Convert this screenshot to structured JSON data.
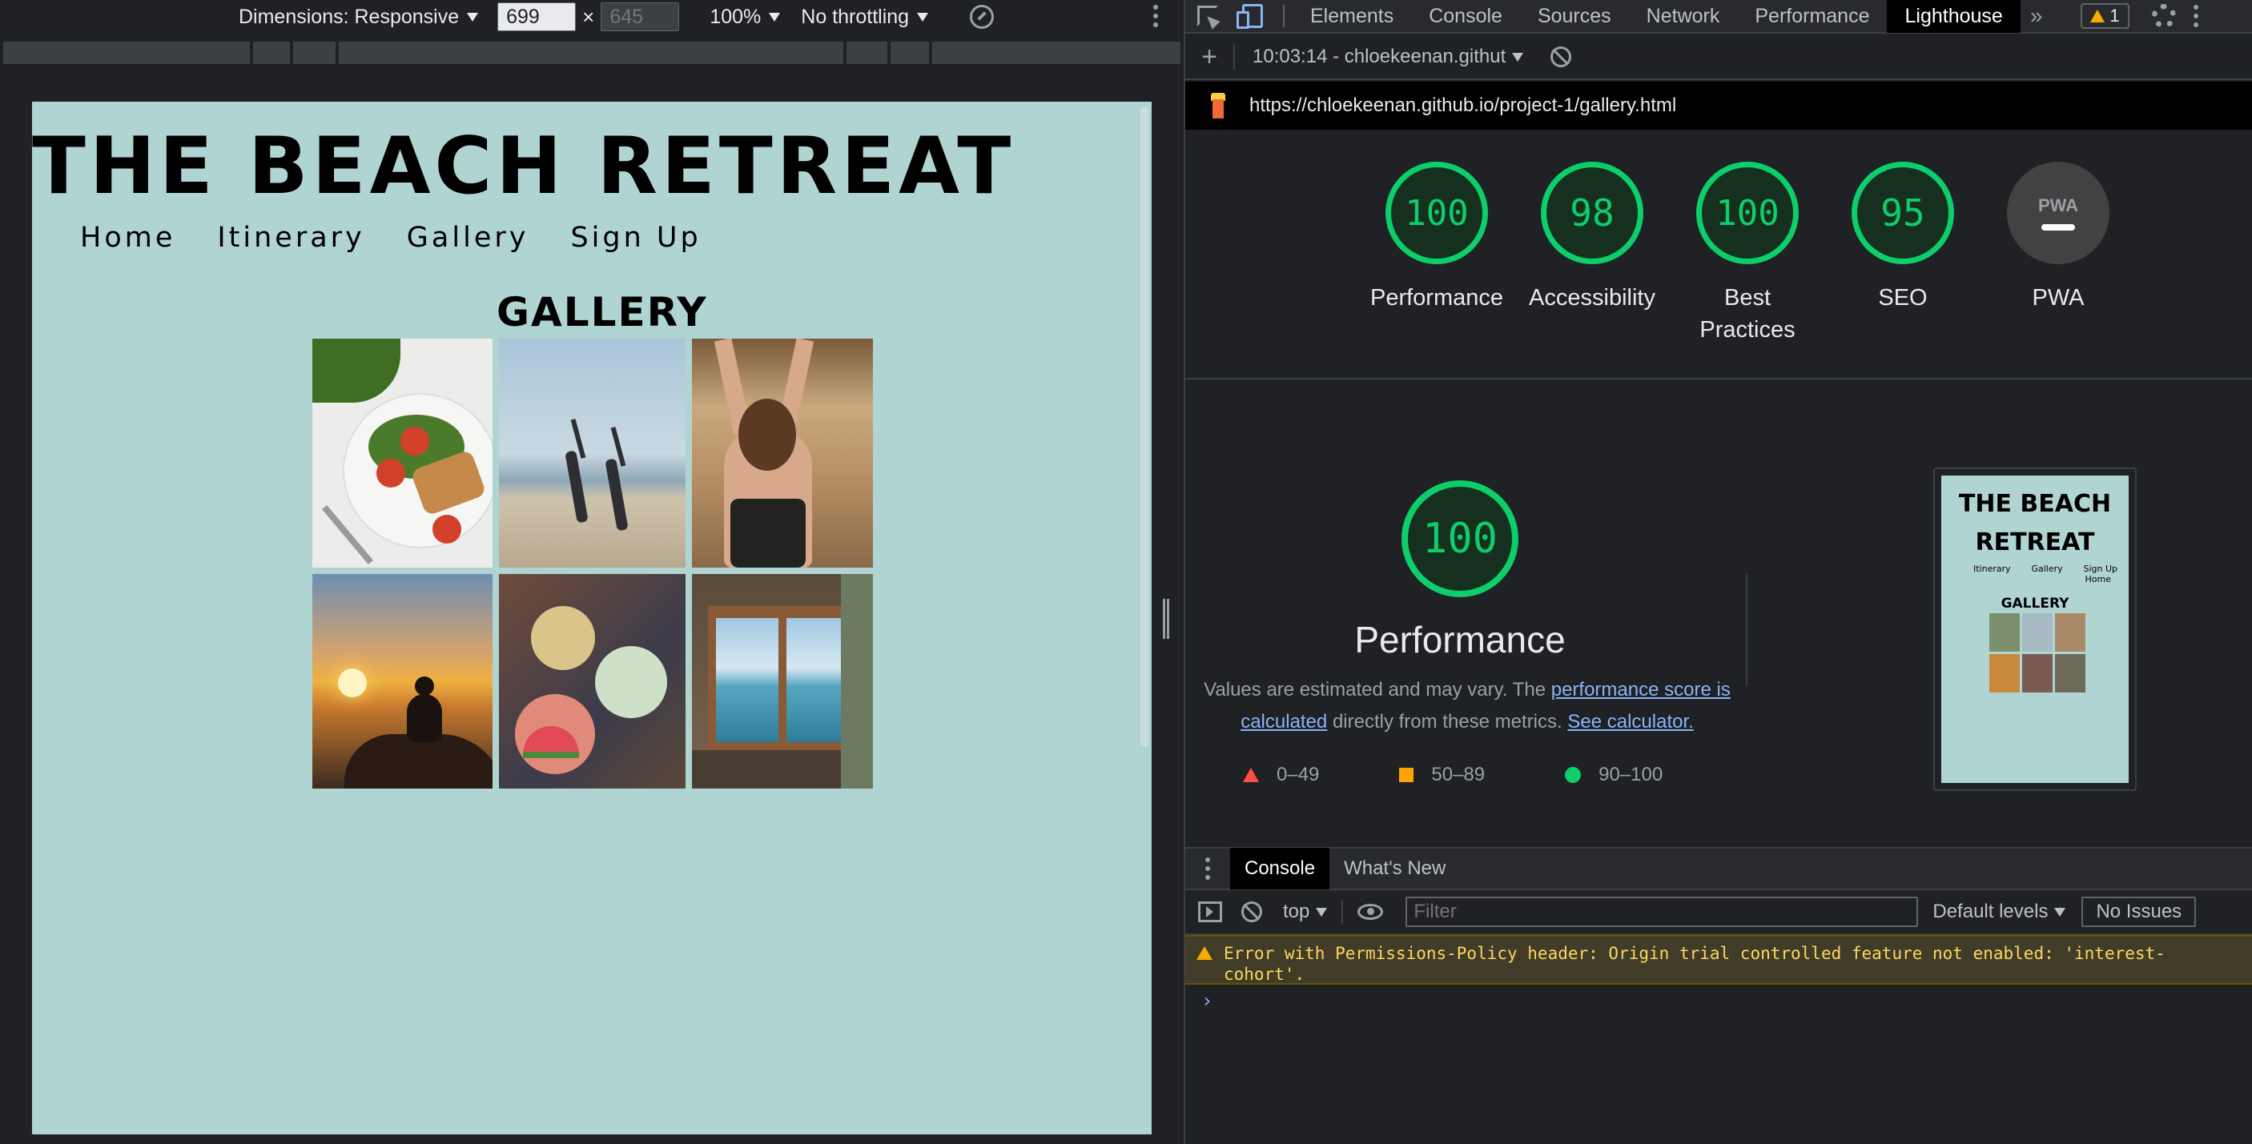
{
  "device_toolbar": {
    "dimensions_label": "Dimensions: Responsive",
    "width_value": "699",
    "height_placeholder": "645",
    "times": "×",
    "zoom": "100%",
    "throttling": "No throttling"
  },
  "site": {
    "title": "THE BEACH RETREAT",
    "nav": [
      "Home",
      "Itinerary",
      "Gallery",
      "Sign Up"
    ],
    "gallery_heading": "GALLERY",
    "bg_color": "#b0d4d2"
  },
  "devtools": {
    "tabs": [
      "Elements",
      "Console",
      "Sources",
      "Network",
      "Performance",
      "Lighthouse"
    ],
    "active_tab": "Lighthouse",
    "more_tabs": "»",
    "warning_count": "1"
  },
  "lighthouse": {
    "report_select": "10:03:14 - chloekeenan.githut",
    "url": "https://chloekeenan.github.io/project-1/gallery.html",
    "scores": [
      {
        "label": "Performance",
        "value": "100"
      },
      {
        "label": "Accessibility",
        "value": "98"
      },
      {
        "label": "Best Practices",
        "value": "100"
      },
      {
        "label": "SEO",
        "value": "95"
      },
      {
        "label": "PWA",
        "value": "PWA"
      }
    ],
    "performance": {
      "score": "100",
      "title": "Performance",
      "desc_prefix": "Values are estimated and may vary. The ",
      "desc_link1": "performance score is calculated",
      "desc_mid": " directly from these metrics. ",
      "desc_link2": "See calculator."
    },
    "legend": [
      "0–49",
      "50–89",
      "90–100"
    ],
    "thumbnail": {
      "title": "THE BEACH RETREAT",
      "nav_row1": [
        "Itinerary",
        "Gallery",
        "Sign Up"
      ],
      "nav_row2": "Home",
      "gallery": "GALLERY"
    },
    "colors": {
      "pass": "#0cce6b",
      "average": "#ffa400",
      "fail": "#ff4e42"
    }
  },
  "drawer": {
    "tabs": [
      "Console",
      "What's New"
    ],
    "context": "top",
    "filter_placeholder": "Filter",
    "levels": "Default levels",
    "issues": "No Issues",
    "warning": "Error with Permissions-Policy header: Origin trial controlled feature not enabled: 'interest-cohort'.",
    "prompt": "›"
  }
}
